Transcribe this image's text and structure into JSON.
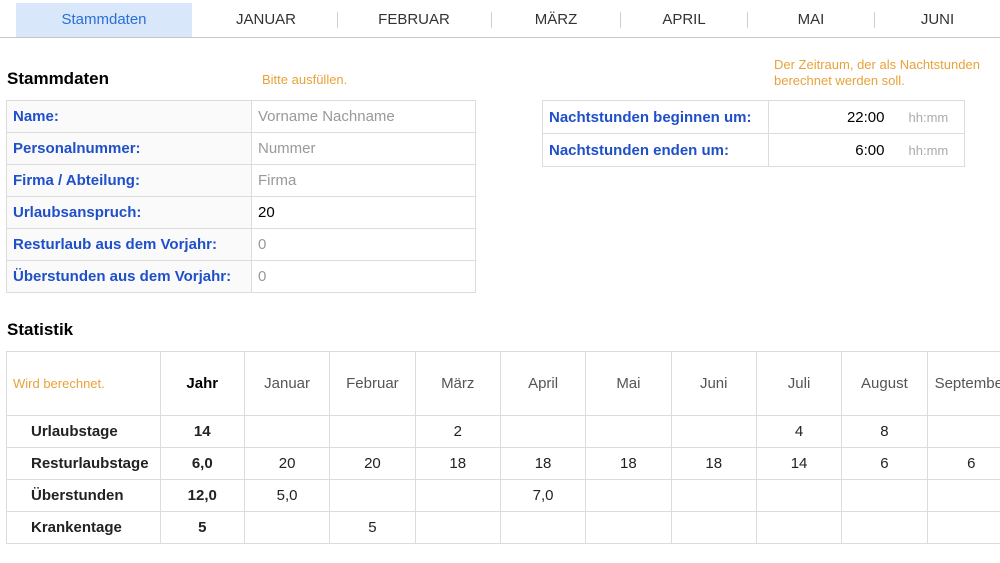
{
  "tabs": [
    "Stammdaten",
    "JANUAR",
    "FEBRUAR",
    "MÄRZ",
    "APRIL",
    "MAI",
    "JUNI"
  ],
  "stammdaten": {
    "title": "Stammdaten",
    "hint": "Bitte ausfüllen.",
    "rows": [
      {
        "label": "Name:",
        "value": "Vorname Nachname"
      },
      {
        "label": "Personalnummer:",
        "value": "Nummer"
      },
      {
        "label": "Firma / Abteilung:",
        "value": "Firma"
      },
      {
        "label": "Urlaubsanspruch:",
        "value": "20"
      },
      {
        "label": "Resturlaub aus dem Vorjahr:",
        "value": "0"
      },
      {
        "label": "Überstunden aus dem Vorjahr:",
        "value": "0"
      }
    ]
  },
  "night": {
    "hint_line1": "Der Zeitraum, der als Nachtstunden",
    "hint_line2": "berechnet werden soll.",
    "rows": [
      {
        "label": "Nachtstunden beginnen um:",
        "time": "22:00",
        "format": "hh:mm"
      },
      {
        "label": "Nachtstunden enden um:",
        "time": "6:00",
        "format": "hh:mm"
      }
    ]
  },
  "statistik": {
    "title": "Statistik",
    "header_hint": "Wird berechnet.",
    "year_label": "Jahr",
    "months": [
      "Januar",
      "Februar",
      "März",
      "April",
      "Mai",
      "Juni",
      "Juli",
      "August",
      "September"
    ],
    "rows": [
      {
        "label": "Urlaubstage",
        "year": "14",
        "values": [
          "",
          "",
          "2",
          "",
          "",
          "",
          "4",
          "8",
          ""
        ]
      },
      {
        "label": "Resturlaubstage",
        "year": "6,0",
        "values": [
          "20",
          "20",
          "18",
          "18",
          "18",
          "18",
          "14",
          "6",
          "6"
        ]
      },
      {
        "label": "Überstunden",
        "year": "12,0",
        "values": [
          "5,0",
          "",
          "",
          "7,0",
          "",
          "",
          "",
          "",
          ""
        ]
      },
      {
        "label": "Krankentage",
        "year": "5",
        "values": [
          "",
          "5",
          "",
          "",
          "",
          "",
          "",
          "",
          ""
        ]
      }
    ]
  }
}
